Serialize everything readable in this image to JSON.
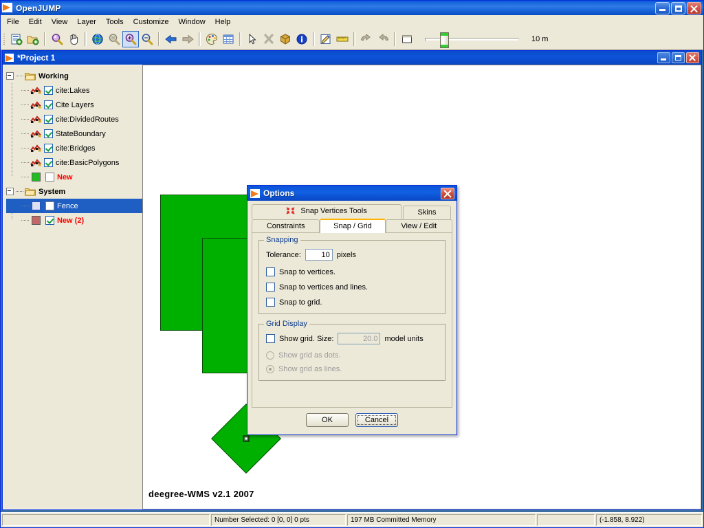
{
  "window": {
    "title": "OpenJUMP",
    "icon": "openjump-logo-icon",
    "buttons": {
      "minimize": "minimize-icon",
      "maximize": "maximize-icon",
      "close": "close-icon"
    }
  },
  "menubar": {
    "items": [
      {
        "label": "File"
      },
      {
        "label": "Edit"
      },
      {
        "label": "View"
      },
      {
        "label": "Layer"
      },
      {
        "label": "Tools"
      },
      {
        "label": "Customize"
      },
      {
        "label": "Window"
      },
      {
        "label": "Help"
      }
    ]
  },
  "toolbar": {
    "buttons": [
      {
        "name": "new-project-icon",
        "selected": false
      },
      {
        "name": "open-project-icon",
        "selected": false
      },
      {
        "name": "zoom-icon",
        "selected": false
      },
      {
        "name": "pan-hand-icon",
        "selected": false
      },
      {
        "name": "zoom-full-extent-globe-icon",
        "selected": false
      },
      {
        "name": "zoom-to-selected-icon",
        "selected": false
      },
      {
        "name": "zoom-in-icon",
        "selected": true
      },
      {
        "name": "zoom-out-icon",
        "selected": false
      },
      {
        "name": "previous-view-arrow-icon",
        "selected": false
      },
      {
        "name": "next-view-arrow-icon",
        "selected": false
      },
      {
        "name": "change-styles-palette-icon",
        "selected": false
      },
      {
        "name": "attribute-table-grid-icon",
        "selected": false
      },
      {
        "name": "select-arrow-icon",
        "selected": false
      },
      {
        "name": "select-features-icon",
        "selected": false
      },
      {
        "name": "feature-info-box-icon",
        "selected": false
      },
      {
        "name": "info-icon",
        "selected": false
      },
      {
        "name": "edit-pencil-icon",
        "selected": false
      },
      {
        "name": "measure-ruler-icon",
        "selected": false
      },
      {
        "name": "undo-icon",
        "selected": false
      },
      {
        "name": "redo-icon",
        "selected": false
      },
      {
        "name": "fence-rectangle-icon",
        "selected": false
      }
    ],
    "scale": {
      "label": "10 m",
      "slider_position_pct": 16
    }
  },
  "project_frame": {
    "title": "*Project 1",
    "icon": "openjump-logo-icon",
    "buttons": {
      "minimize": "minimize-icon",
      "maximize": "restore-icon",
      "close": "close-icon"
    }
  },
  "layer_tree": {
    "nodes": [
      {
        "label": "Working",
        "type": "category",
        "expanded": true,
        "children": [
          {
            "label": "cite:Lakes",
            "checked": true,
            "icon": "vector-layer-icon",
            "red": false
          },
          {
            "label": "Cite Layers",
            "checked": true,
            "icon": "vector-layer-icon",
            "red": false
          },
          {
            "label": "cite:DividedRoutes",
            "checked": true,
            "icon": "vector-layer-icon",
            "red": false
          },
          {
            "label": "StateBoundary",
            "checked": true,
            "icon": "vector-layer-icon",
            "red": false
          },
          {
            "label": "cite:Bridges",
            "checked": true,
            "icon": "vector-layer-icon",
            "red": false
          },
          {
            "label": "cite:BasicPolygons",
            "checked": true,
            "icon": "vector-layer-icon",
            "red": false
          },
          {
            "label": "New",
            "checked": false,
            "icon": "color-swatch-icon",
            "swatch": "#22bb22",
            "red": true
          }
        ]
      },
      {
        "label": "System",
        "type": "category",
        "expanded": true,
        "children": [
          {
            "label": "Fence",
            "checked": false,
            "icon": "color-swatch-icon",
            "swatch": "#e8e8f8",
            "red": false,
            "selected": true
          },
          {
            "label": "New (2)",
            "checked": true,
            "icon": "color-swatch-icon",
            "swatch": "#c06868",
            "red": true
          }
        ]
      }
    ]
  },
  "map": {
    "watermark": "deegree-WMS v2.1 2007",
    "shapes": [
      {
        "name": "polygon-upper-left",
        "fill": "#00b000",
        "stroke": "#064d06"
      },
      {
        "name": "polygon-lower-right",
        "fill": "#00b000",
        "stroke": "#064d06"
      },
      {
        "name": "polygon-diamond",
        "fill": "#00b000",
        "stroke": "#064d06"
      }
    ]
  },
  "dialog": {
    "title": "Options",
    "icon": "openjump-logo-icon",
    "close_icon": "close-icon",
    "tabs_row1": [
      {
        "label": "Snap Vertices Tools",
        "active": false,
        "icon": "snap-vertices-icon"
      },
      {
        "label": "Skins",
        "active": false
      }
    ],
    "tabs_row2": [
      {
        "label": "Constraints",
        "active": false
      },
      {
        "label": "Snap / Grid",
        "active": true
      },
      {
        "label": "View / Edit",
        "active": false
      }
    ],
    "snapping": {
      "legend": "Snapping",
      "tolerance_label": "Tolerance:",
      "tolerance_value": "10",
      "tolerance_units": "pixels",
      "checkboxes": [
        {
          "label": "Snap to vertices.",
          "checked": false
        },
        {
          "label": "Snap to vertices and lines.",
          "checked": false
        },
        {
          "label": "Snap to grid.",
          "checked": false
        }
      ]
    },
    "grid_display": {
      "legend": "Grid Display",
      "show_grid_label": "Show grid. Size:",
      "show_grid_checked": false,
      "size_value": "20.0",
      "size_units": "model units",
      "radios": [
        {
          "label": "Show grid as dots.",
          "selected": false,
          "disabled": true
        },
        {
          "label": "Show grid as lines.",
          "selected": true,
          "disabled": true
        }
      ]
    },
    "buttons": [
      {
        "label": "OK",
        "focused": false
      },
      {
        "label": "Cancel",
        "focused": true
      }
    ]
  },
  "statusbar": {
    "cells": [
      {
        "name": "status-message",
        "text": ""
      },
      {
        "name": "selection-info",
        "text": "Number Selected: 0 [0, 0] 0 pts"
      },
      {
        "name": "memory-info",
        "text": "197 MB Committed Memory"
      },
      {
        "name": "spacer-cell",
        "text": ""
      },
      {
        "name": "coordinates",
        "text": "(-1.858, 8.922)"
      }
    ]
  }
}
